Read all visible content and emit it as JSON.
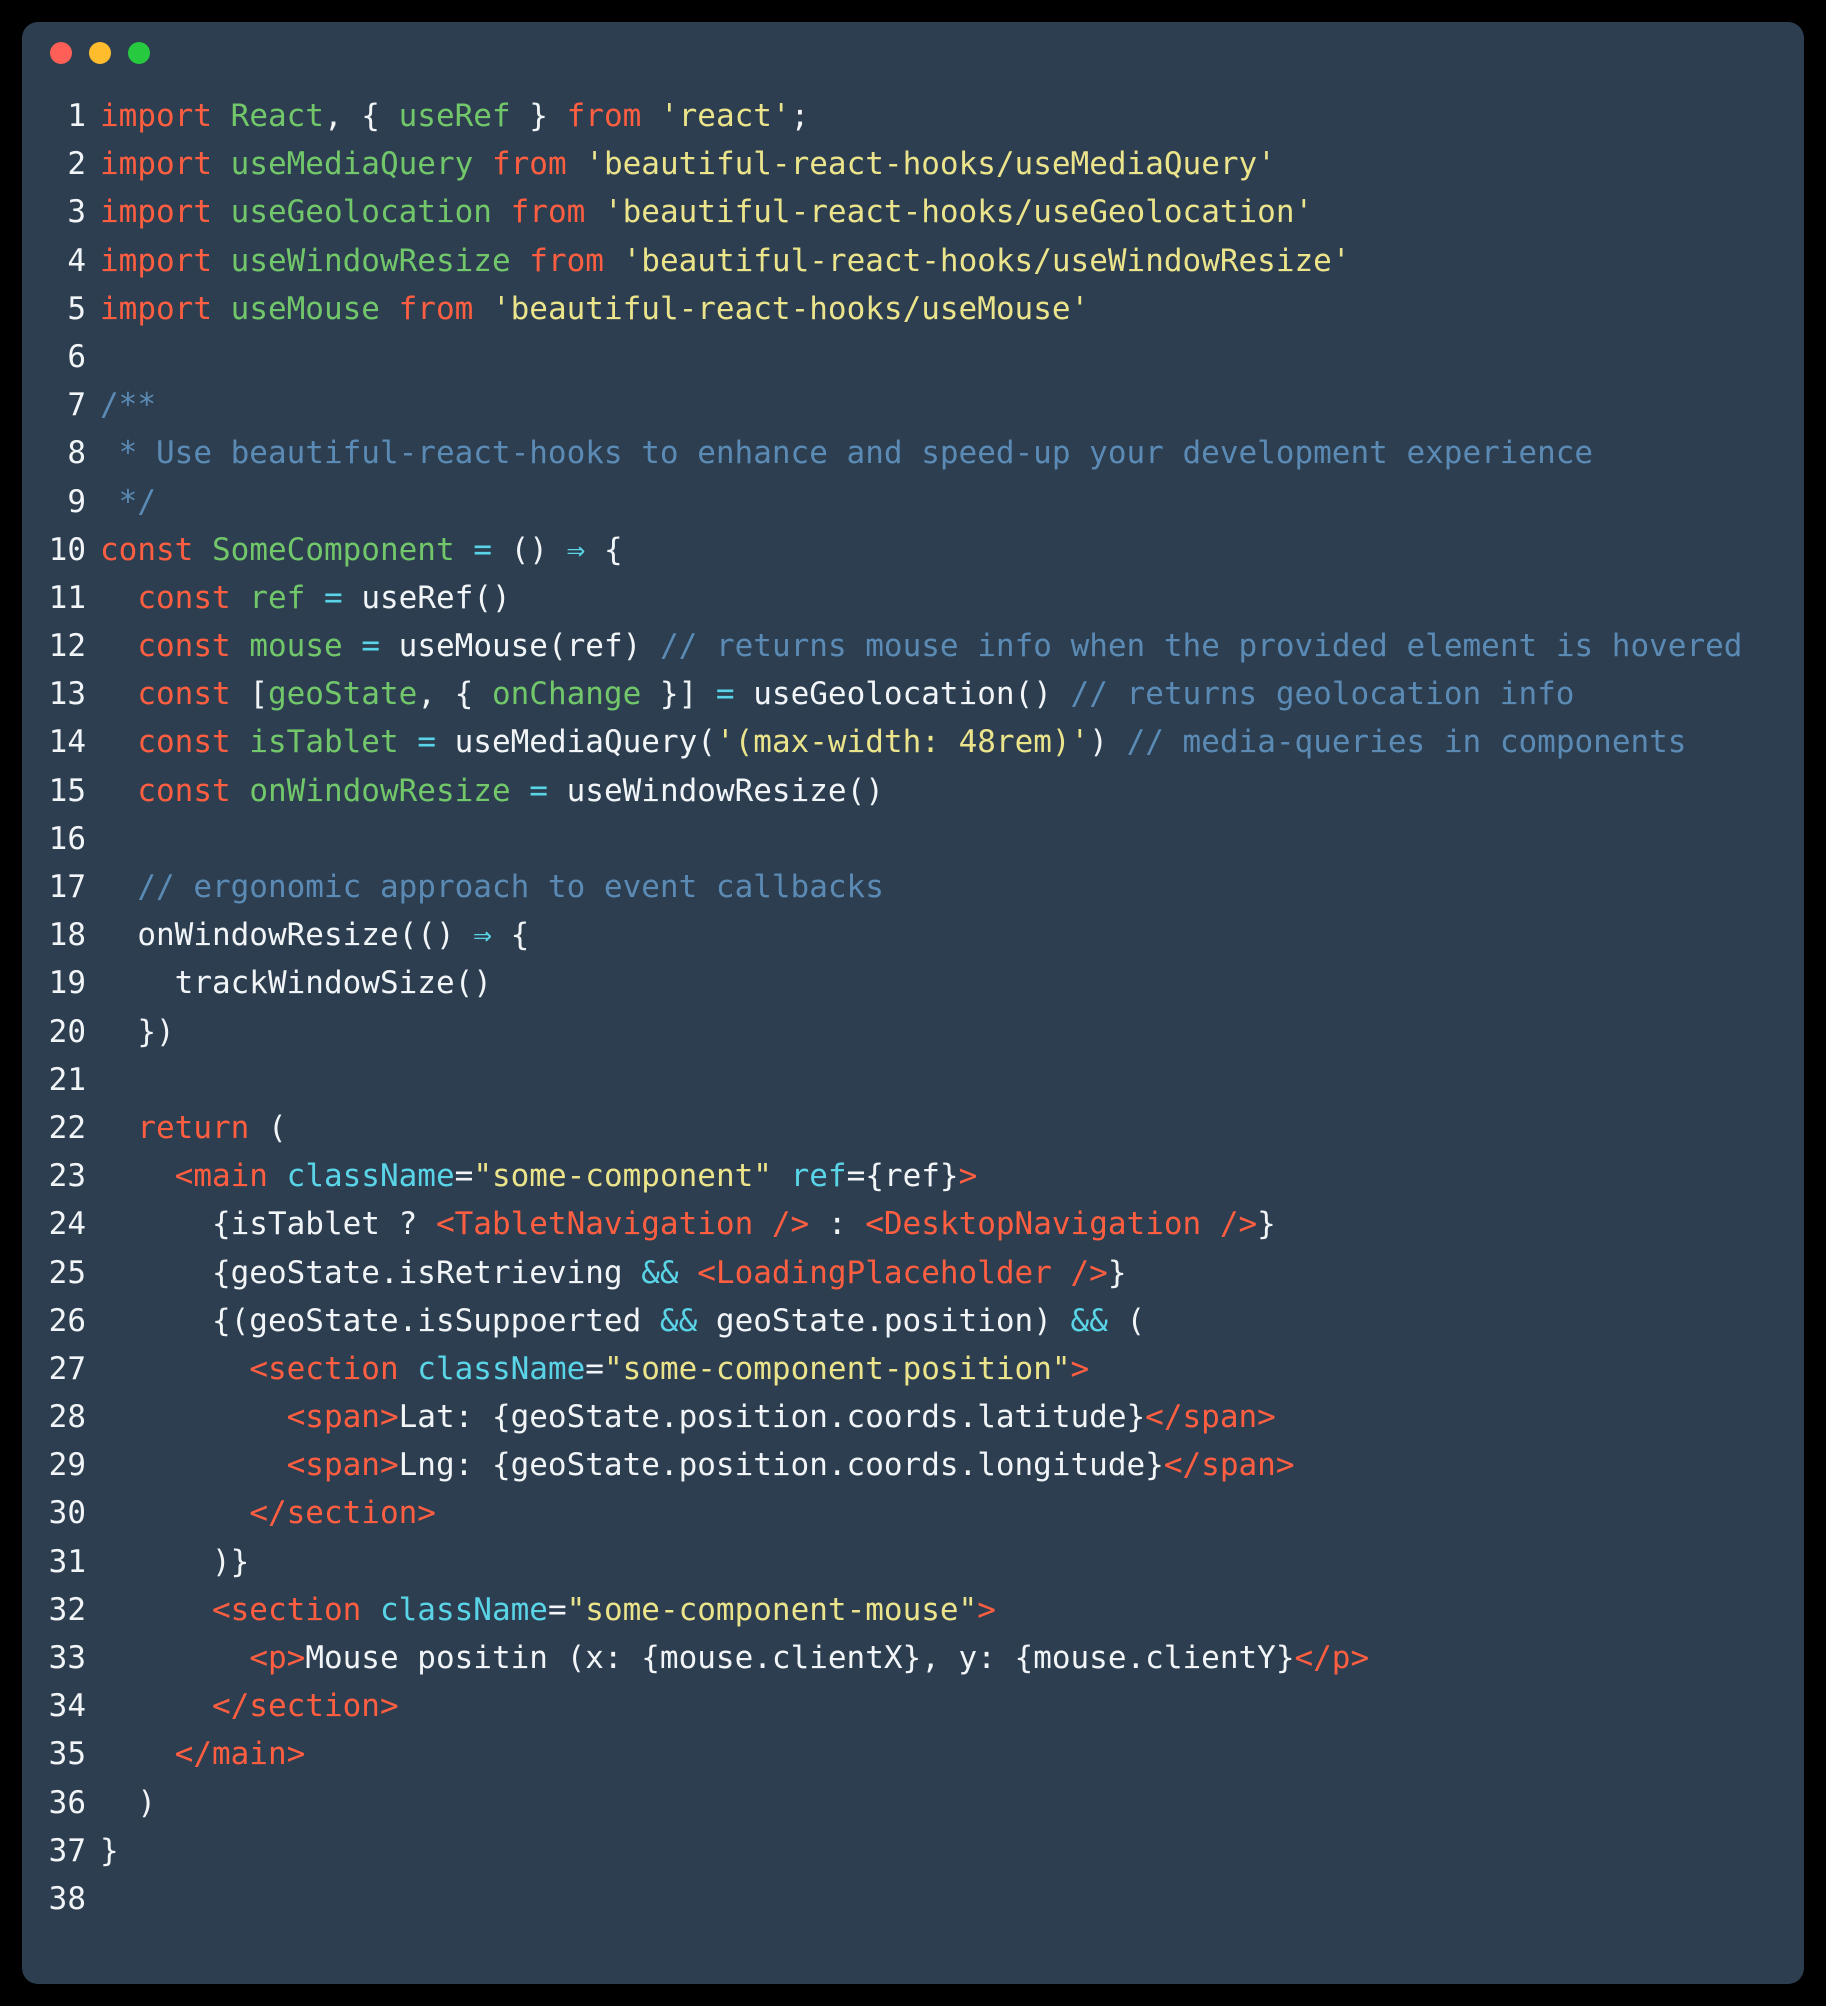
{
  "window": {
    "title": "",
    "traffic_lights": [
      {
        "name": "close",
        "color": "#ff5f56"
      },
      {
        "name": "minimize",
        "color": "#ffbd2e"
      },
      {
        "name": "maximize",
        "color": "#27c93f"
      }
    ],
    "background": "#2c3e50",
    "page_background": "#000000"
  },
  "theme": {
    "keyword": "#ff5e41",
    "identifier": "#72c76a",
    "string": "#ece48b",
    "comment": "#5b8bb5",
    "operator": "#5ad5e8",
    "plain": "#f2f5f7",
    "tag": "#ff5e41",
    "attribute": "#5ad5e8",
    "gutter": "#f2f5f7"
  },
  "editor": {
    "language": "jsx",
    "first_line": 1,
    "last_line": 38,
    "lines": [
      {
        "n": "1",
        "tokens": [
          {
            "c": "kw",
            "t": "import"
          },
          {
            "c": "plain",
            "t": " "
          },
          {
            "c": "fn",
            "t": "React"
          },
          {
            "c": "plain",
            "t": ", { "
          },
          {
            "c": "fn",
            "t": "useRef"
          },
          {
            "c": "plain",
            "t": " } "
          },
          {
            "c": "kw",
            "t": "from"
          },
          {
            "c": "plain",
            "t": " "
          },
          {
            "c": "str",
            "t": "'react'"
          },
          {
            "c": "plain",
            "t": ";"
          }
        ]
      },
      {
        "n": "2",
        "tokens": [
          {
            "c": "kw",
            "t": "import"
          },
          {
            "c": "plain",
            "t": " "
          },
          {
            "c": "fn",
            "t": "useMediaQuery"
          },
          {
            "c": "plain",
            "t": " "
          },
          {
            "c": "kw",
            "t": "from"
          },
          {
            "c": "plain",
            "t": " "
          },
          {
            "c": "str",
            "t": "'beautiful-react-hooks/useMediaQuery'"
          }
        ]
      },
      {
        "n": "3",
        "tokens": [
          {
            "c": "kw",
            "t": "import"
          },
          {
            "c": "plain",
            "t": " "
          },
          {
            "c": "fn",
            "t": "useGeolocation"
          },
          {
            "c": "plain",
            "t": " "
          },
          {
            "c": "kw",
            "t": "from"
          },
          {
            "c": "plain",
            "t": " "
          },
          {
            "c": "str",
            "t": "'beautiful-react-hooks/useGeolocation'"
          }
        ]
      },
      {
        "n": "4",
        "tokens": [
          {
            "c": "kw",
            "t": "import"
          },
          {
            "c": "plain",
            "t": " "
          },
          {
            "c": "fn",
            "t": "useWindowResize"
          },
          {
            "c": "plain",
            "t": " "
          },
          {
            "c": "kw",
            "t": "from"
          },
          {
            "c": "plain",
            "t": " "
          },
          {
            "c": "str",
            "t": "'beautiful-react-hooks/useWindowResize'"
          }
        ]
      },
      {
        "n": "5",
        "tokens": [
          {
            "c": "kw",
            "t": "import"
          },
          {
            "c": "plain",
            "t": " "
          },
          {
            "c": "fn",
            "t": "useMouse"
          },
          {
            "c": "plain",
            "t": " "
          },
          {
            "c": "kw",
            "t": "from"
          },
          {
            "c": "plain",
            "t": " "
          },
          {
            "c": "str",
            "t": "'beautiful-react-hooks/useMouse'"
          }
        ]
      },
      {
        "n": "6",
        "tokens": []
      },
      {
        "n": "7",
        "tokens": [
          {
            "c": "cmt",
            "t": "/**"
          }
        ]
      },
      {
        "n": "8",
        "tokens": [
          {
            "c": "cmt",
            "t": " * Use beautiful-react-hooks to enhance and speed-up your development experience"
          }
        ]
      },
      {
        "n": "9",
        "tokens": [
          {
            "c": "cmt",
            "t": " */"
          }
        ]
      },
      {
        "n": "10",
        "tokens": [
          {
            "c": "kw",
            "t": "const"
          },
          {
            "c": "plain",
            "t": " "
          },
          {
            "c": "fn",
            "t": "SomeComponent"
          },
          {
            "c": "plain",
            "t": " "
          },
          {
            "c": "op",
            "t": "="
          },
          {
            "c": "plain",
            "t": " () "
          },
          {
            "c": "op",
            "t": "⇒"
          },
          {
            "c": "plain",
            "t": " {"
          }
        ]
      },
      {
        "n": "11",
        "tokens": [
          {
            "c": "plain",
            "t": "  "
          },
          {
            "c": "kw",
            "t": "const"
          },
          {
            "c": "plain",
            "t": " "
          },
          {
            "c": "fn",
            "t": "ref"
          },
          {
            "c": "plain",
            "t": " "
          },
          {
            "c": "op",
            "t": "="
          },
          {
            "c": "plain",
            "t": " useRef()"
          }
        ]
      },
      {
        "n": "12",
        "tokens": [
          {
            "c": "plain",
            "t": "  "
          },
          {
            "c": "kw",
            "t": "const"
          },
          {
            "c": "plain",
            "t": " "
          },
          {
            "c": "fn",
            "t": "mouse"
          },
          {
            "c": "plain",
            "t": " "
          },
          {
            "c": "op",
            "t": "="
          },
          {
            "c": "plain",
            "t": " useMouse(ref) "
          },
          {
            "c": "cmt",
            "t": "// returns mouse info when the provided element is hovered"
          }
        ]
      },
      {
        "n": "13",
        "tokens": [
          {
            "c": "plain",
            "t": "  "
          },
          {
            "c": "kw",
            "t": "const"
          },
          {
            "c": "plain",
            "t": " ["
          },
          {
            "c": "fn",
            "t": "geoState"
          },
          {
            "c": "plain",
            "t": ", { "
          },
          {
            "c": "fn",
            "t": "onChange"
          },
          {
            "c": "plain",
            "t": " }] "
          },
          {
            "c": "op",
            "t": "="
          },
          {
            "c": "plain",
            "t": " useGeolocation() "
          },
          {
            "c": "cmt",
            "t": "// returns geolocation info"
          }
        ]
      },
      {
        "n": "14",
        "tokens": [
          {
            "c": "plain",
            "t": "  "
          },
          {
            "c": "kw",
            "t": "const"
          },
          {
            "c": "plain",
            "t": " "
          },
          {
            "c": "fn",
            "t": "isTablet"
          },
          {
            "c": "plain",
            "t": " "
          },
          {
            "c": "op",
            "t": "="
          },
          {
            "c": "plain",
            "t": " useMediaQuery("
          },
          {
            "c": "str",
            "t": "'(max-width: 48rem)'"
          },
          {
            "c": "plain",
            "t": ") "
          },
          {
            "c": "cmt",
            "t": "// media-queries in components"
          }
        ]
      },
      {
        "n": "15",
        "tokens": [
          {
            "c": "plain",
            "t": "  "
          },
          {
            "c": "kw",
            "t": "const"
          },
          {
            "c": "plain",
            "t": " "
          },
          {
            "c": "fn",
            "t": "onWindowResize"
          },
          {
            "c": "plain",
            "t": " "
          },
          {
            "c": "op",
            "t": "="
          },
          {
            "c": "plain",
            "t": " useWindowResize()"
          }
        ]
      },
      {
        "n": "16",
        "tokens": []
      },
      {
        "n": "17",
        "tokens": [
          {
            "c": "plain",
            "t": "  "
          },
          {
            "c": "cmt",
            "t": "// ergonomic approach to event callbacks"
          }
        ]
      },
      {
        "n": "18",
        "tokens": [
          {
            "c": "plain",
            "t": "  onWindowResize(() "
          },
          {
            "c": "op",
            "t": "⇒"
          },
          {
            "c": "plain",
            "t": " {"
          }
        ]
      },
      {
        "n": "19",
        "tokens": [
          {
            "c": "plain",
            "t": "    trackWindowSize()"
          }
        ]
      },
      {
        "n": "20",
        "tokens": [
          {
            "c": "plain",
            "t": "  })"
          }
        ]
      },
      {
        "n": "21",
        "tokens": []
      },
      {
        "n": "22",
        "tokens": [
          {
            "c": "plain",
            "t": "  "
          },
          {
            "c": "kw",
            "t": "return"
          },
          {
            "c": "plain",
            "t": " ("
          }
        ]
      },
      {
        "n": "23",
        "tokens": [
          {
            "c": "plain",
            "t": "    "
          },
          {
            "c": "tag",
            "t": "<main"
          },
          {
            "c": "plain",
            "t": " "
          },
          {
            "c": "attr",
            "t": "className"
          },
          {
            "c": "plain",
            "t": "="
          },
          {
            "c": "str",
            "t": "\"some-component\""
          },
          {
            "c": "plain",
            "t": " "
          },
          {
            "c": "attr",
            "t": "ref"
          },
          {
            "c": "plain",
            "t": "={ref}"
          },
          {
            "c": "tag",
            "t": ">"
          }
        ]
      },
      {
        "n": "24",
        "tokens": [
          {
            "c": "plain",
            "t": "      {isTablet ? "
          },
          {
            "c": "tag",
            "t": "<TabletNavigation />"
          },
          {
            "c": "plain",
            "t": " : "
          },
          {
            "c": "tag",
            "t": "<DesktopNavigation />"
          },
          {
            "c": "plain",
            "t": "}"
          }
        ]
      },
      {
        "n": "25",
        "tokens": [
          {
            "c": "plain",
            "t": "      {geoState.isRetrieving "
          },
          {
            "c": "op",
            "t": "&&"
          },
          {
            "c": "plain",
            "t": " "
          },
          {
            "c": "tag",
            "t": "<LoadingPlaceholder />"
          },
          {
            "c": "plain",
            "t": "}"
          }
        ]
      },
      {
        "n": "26",
        "tokens": [
          {
            "c": "plain",
            "t": "      {(geoState.isSuppoerted "
          },
          {
            "c": "op",
            "t": "&&"
          },
          {
            "c": "plain",
            "t": " geoState.position) "
          },
          {
            "c": "op",
            "t": "&&"
          },
          {
            "c": "plain",
            "t": " ("
          }
        ]
      },
      {
        "n": "27",
        "tokens": [
          {
            "c": "plain",
            "t": "        "
          },
          {
            "c": "tag",
            "t": "<section"
          },
          {
            "c": "plain",
            "t": " "
          },
          {
            "c": "attr",
            "t": "className"
          },
          {
            "c": "plain",
            "t": "="
          },
          {
            "c": "str",
            "t": "\"some-component-position\""
          },
          {
            "c": "tag",
            "t": ">"
          }
        ]
      },
      {
        "n": "28",
        "tokens": [
          {
            "c": "plain",
            "t": "          "
          },
          {
            "c": "tag",
            "t": "<span>"
          },
          {
            "c": "plain",
            "t": "Lat: {geoState.position.coords.latitude}"
          },
          {
            "c": "tag",
            "t": "</span>"
          }
        ]
      },
      {
        "n": "29",
        "tokens": [
          {
            "c": "plain",
            "t": "          "
          },
          {
            "c": "tag",
            "t": "<span>"
          },
          {
            "c": "plain",
            "t": "Lng: {geoState.position.coords.longitude}"
          },
          {
            "c": "tag",
            "t": "</span>"
          }
        ]
      },
      {
        "n": "30",
        "tokens": [
          {
            "c": "plain",
            "t": "        "
          },
          {
            "c": "tag",
            "t": "</section>"
          }
        ]
      },
      {
        "n": "31",
        "tokens": [
          {
            "c": "plain",
            "t": "      )}"
          }
        ]
      },
      {
        "n": "32",
        "tokens": [
          {
            "c": "plain",
            "t": "      "
          },
          {
            "c": "tag",
            "t": "<section"
          },
          {
            "c": "plain",
            "t": " "
          },
          {
            "c": "attr",
            "t": "className"
          },
          {
            "c": "plain",
            "t": "="
          },
          {
            "c": "str",
            "t": "\"some-component-mouse\""
          },
          {
            "c": "tag",
            "t": ">"
          }
        ]
      },
      {
        "n": "33",
        "tokens": [
          {
            "c": "plain",
            "t": "        "
          },
          {
            "c": "tag",
            "t": "<p>"
          },
          {
            "c": "plain",
            "t": "Mouse positin (x: {mouse.clientX}, y: {mouse.clientY}"
          },
          {
            "c": "tag",
            "t": "</p>"
          }
        ]
      },
      {
        "n": "34",
        "tokens": [
          {
            "c": "plain",
            "t": "      "
          },
          {
            "c": "tag",
            "t": "</section>"
          }
        ]
      },
      {
        "n": "35",
        "tokens": [
          {
            "c": "plain",
            "t": "    "
          },
          {
            "c": "tag",
            "t": "</main>"
          }
        ]
      },
      {
        "n": "36",
        "tokens": [
          {
            "c": "plain",
            "t": "  )"
          }
        ]
      },
      {
        "n": "37",
        "tokens": [
          {
            "c": "plain",
            "t": "}"
          }
        ]
      },
      {
        "n": "38",
        "tokens": []
      }
    ]
  }
}
